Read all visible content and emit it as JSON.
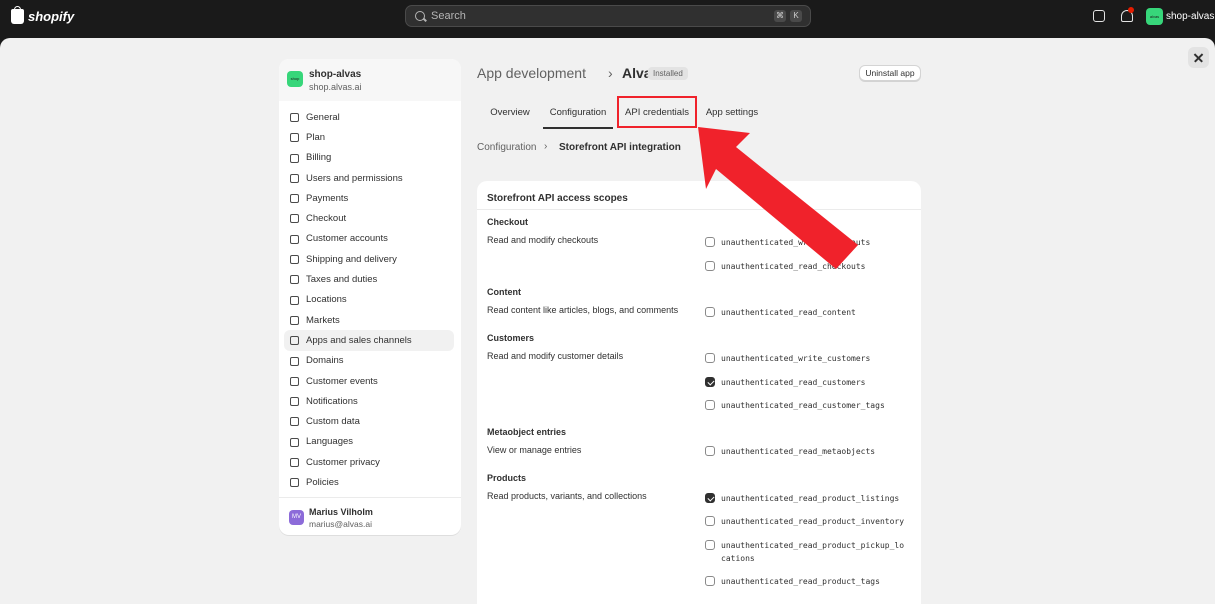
{
  "topbar": {
    "brand": "shopify",
    "search_placeholder": "Search",
    "shortcut_keys": [
      "⌘",
      "K"
    ],
    "store_avatar_text": "alvas",
    "store_name": "shop-alvas"
  },
  "sidebar": {
    "shop_avatar_text": "shop",
    "shop_name": "shop-alvas",
    "shop_domain": "shop.alvas.ai",
    "items": [
      {
        "label": "General"
      },
      {
        "label": "Plan"
      },
      {
        "label": "Billing"
      },
      {
        "label": "Users and permissions"
      },
      {
        "label": "Payments"
      },
      {
        "label": "Checkout"
      },
      {
        "label": "Customer accounts"
      },
      {
        "label": "Shipping and delivery"
      },
      {
        "label": "Taxes and duties"
      },
      {
        "label": "Locations"
      },
      {
        "label": "Markets"
      },
      {
        "label": "Apps and sales channels"
      },
      {
        "label": "Domains"
      },
      {
        "label": "Customer events"
      },
      {
        "label": "Notifications"
      },
      {
        "label": "Custom data"
      },
      {
        "label": "Languages"
      },
      {
        "label": "Customer privacy"
      },
      {
        "label": "Policies"
      }
    ],
    "active_item": "Apps and sales channels",
    "user": {
      "initials": "MV",
      "name": "Marius Vilholm",
      "email": "marius@alvas.ai"
    }
  },
  "header": {
    "breadcrumb": "App development",
    "separator": "›",
    "app_name": "Alvas",
    "badge": "Installed",
    "uninstall_label": "Uninstall app"
  },
  "tabs": [
    {
      "label": "Overview"
    },
    {
      "label": "Configuration"
    },
    {
      "label": "API credentials"
    },
    {
      "label": "App settings"
    }
  ],
  "active_tab": "Configuration",
  "highlighted_tab": "API credentials",
  "annotation_color": "#f0222b",
  "subcrumb": {
    "parent": "Configuration",
    "separator": "›",
    "current": "Storefront API integration"
  },
  "scopes_card": {
    "title": "Storefront API access scopes",
    "sections": [
      {
        "title": "Checkout",
        "desc": "Read and modify checkouts",
        "scopes": [
          {
            "name": "unauthenticated_write_checkouts",
            "checked": false
          },
          {
            "name": "unauthenticated_read_checkouts",
            "checked": false
          }
        ]
      },
      {
        "title": "Content",
        "desc": "Read content like articles, blogs, and comments",
        "scopes": [
          {
            "name": "unauthenticated_read_content",
            "checked": false
          }
        ]
      },
      {
        "title": "Customers",
        "desc": "Read and modify customer details",
        "scopes": [
          {
            "name": "unauthenticated_write_customers",
            "checked": false
          },
          {
            "name": "unauthenticated_read_customers",
            "checked": true
          },
          {
            "name": "unauthenticated_read_customer_tags",
            "checked": false
          }
        ]
      },
      {
        "title": "Metaobject entries",
        "desc": "View or manage entries",
        "scopes": [
          {
            "name": "unauthenticated_read_metaobjects",
            "checked": false
          }
        ]
      },
      {
        "title": "Products",
        "desc": "Read products, variants, and collections",
        "scopes": [
          {
            "name": "unauthenticated_read_product_listings",
            "checked": true
          },
          {
            "name": "unauthenticated_read_product_inventory",
            "checked": false
          },
          {
            "name": "unauthenticated_read_product_pickup_locations",
            "checked": false
          },
          {
            "name": "unauthenticated_read_product_tags",
            "checked": false
          }
        ]
      }
    ]
  }
}
